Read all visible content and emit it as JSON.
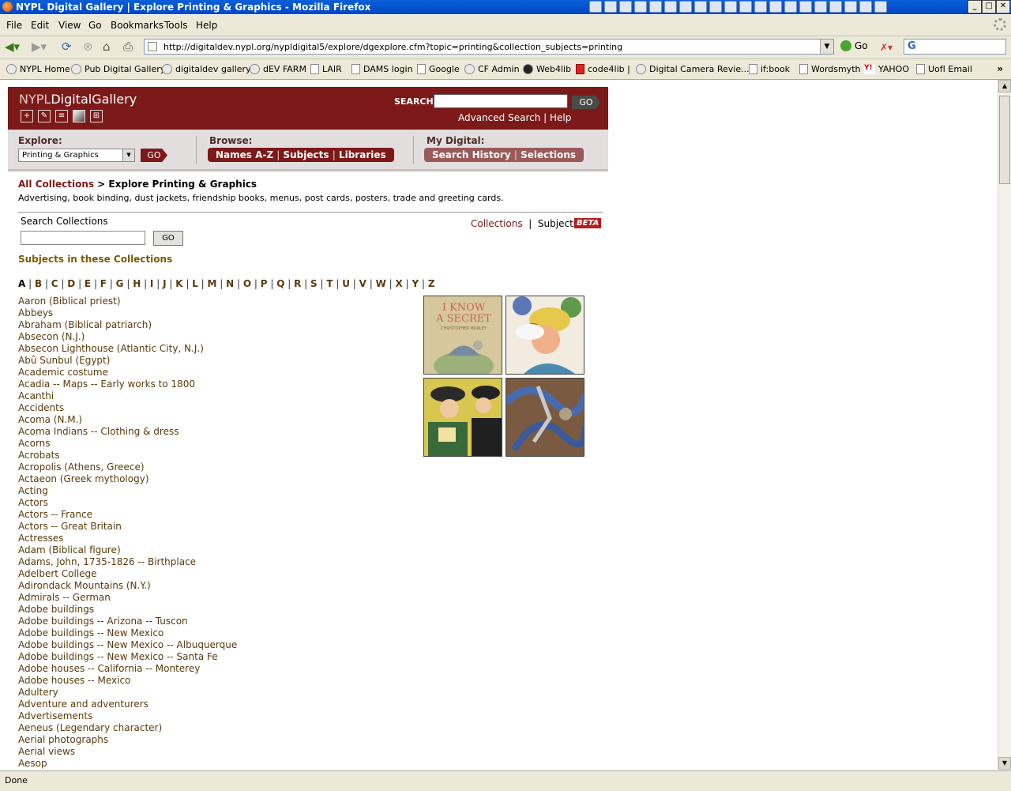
{
  "window": {
    "title": "NYPL Digital Gallery | Explore Printing & Graphics - Mozilla Firefox",
    "controls": [
      "_",
      "□",
      "✕"
    ]
  },
  "menu": [
    "File",
    "Edit",
    "View",
    "Go",
    "Bookmarks",
    "Tools",
    "Help"
  ],
  "nav": {
    "url": "http://digitaldev.nypl.org/nypldigital5/explore/dgexplore.cfm?topic=printing&collection_subjects=printing",
    "go_label": "Go",
    "search_engine": "G"
  },
  "bookmarks": [
    "NYPL Home",
    "Pub Digital Gallery",
    "digitaldev gallery",
    "dEV FARM",
    "LAIR",
    "DAMS login",
    "Google",
    "CF Admin",
    "Web4lib",
    "code4lib |",
    "Digital Camera Revie...",
    "if:book",
    "Wordsmyth",
    "YAHOO",
    "UofI Email"
  ],
  "status": "Done",
  "site": {
    "logo_a": "NYPL",
    "logo_b": "DigitalGallery",
    "search_label": "SEARCH:",
    "go": "GO",
    "adv_search": "Advanced Search",
    "help": "Help",
    "explore_label": "Explore:",
    "explore_selected": "Printing & Graphics",
    "browse_label": "Browse:",
    "browse_items": [
      "Names A-Z",
      "Subjects",
      "Libraries"
    ],
    "mydigital_label": "My Digital:",
    "mydigital_items": [
      "Search History",
      "Selections"
    ],
    "crumb_link": "All Collections",
    "crumb_rest": " > Explore Printing & Graphics",
    "description": "Advertising, book binding, dust jackets, friendship books, menus, post cards, posters, trade and greeting cards.",
    "search_collections": "Search Collections",
    "tab_collections": "Collections",
    "tab_subjects": "Subjects",
    "beta": "BETA",
    "subjects_title": "Subjects in these Collections",
    "alphabet": [
      "A",
      "B",
      "C",
      "D",
      "E",
      "F",
      "G",
      "H",
      "I",
      "J",
      "K",
      "L",
      "M",
      "N",
      "O",
      "P",
      "Q",
      "R",
      "S",
      "T",
      "U",
      "V",
      "W",
      "X",
      "Y",
      "Z"
    ],
    "current_letter": "A",
    "subjects": [
      "Aaron (Biblical priest)",
      "Abbeys",
      "Abraham (Biblical patriarch)",
      "Absecon (N.J.)",
      "Absecon Lighthouse (Atlantic City, N.J.)",
      "Abû Sunbul (Egypt)",
      "Academic costume",
      "Acadia -- Maps -- Early works to 1800",
      "Acanthi",
      "Accidents",
      "Acoma (N.M.)",
      "Acoma Indians -- Clothing & dress",
      "Acorns",
      "Acrobats",
      "Acropolis (Athens, Greece)",
      "Actaeon (Greek mythology)",
      "Acting",
      "Actors",
      "Actors -- France",
      "Actors -- Great Britain",
      "Actresses",
      "Adam (Biblical figure)",
      "Adams, John, 1735-1826 -- Birthplace",
      "Adelbert College",
      "Adirondack Mountains (N.Y.)",
      "Admirals -- German",
      "Adobe buildings",
      "Adobe buildings -- Arizona -- Tuscon",
      "Adobe buildings -- New Mexico",
      "Adobe buildings -- New Mexico -- Albuquerque",
      "Adobe buildings -- New Mexico -- Santa Fe",
      "Adobe houses -- California -- Monterey",
      "Adobe houses -- Mexico",
      "Adultery",
      "Adventure and adventurers",
      "Advertisements",
      "Aeneus (Legendary character)",
      "Aerial photographs",
      "Aerial views",
      "Aesop"
    ],
    "thumb1_text": [
      "I KNOW",
      "A SECRET",
      "CHRISTOPHER MORLEY"
    ]
  }
}
